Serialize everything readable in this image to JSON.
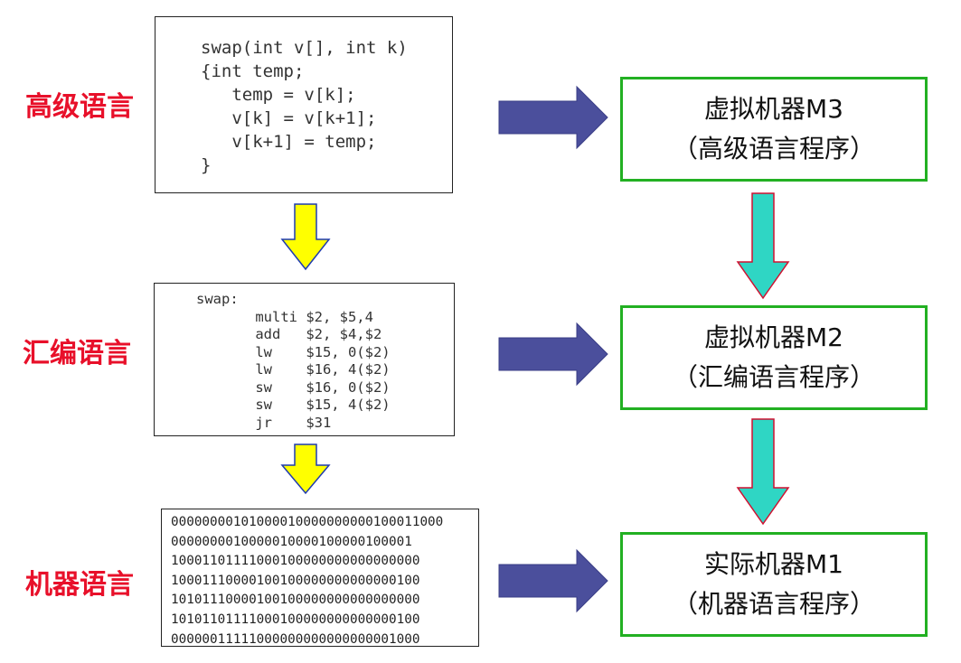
{
  "levels": [
    {
      "label": "高级语言"
    },
    {
      "label": "汇编语言"
    },
    {
      "label": "机器语言"
    }
  ],
  "high_level_code": "swap(int v[], int k)\n{int temp;\n   temp = v[k];\n   v[k] = v[k+1];\n   v[k+1] = temp;\n}",
  "assembly_code": "swap:\n       multi $2, $5,4\n       add   $2, $4,$2\n       lw    $15, 0($2)\n       lw    $16, 4($2)\n       sw    $16, 0($2)\n       sw    $15, 4($2)\n       jr    $31",
  "machine_code": "00000000101000010000000000100011000\n0000000010000010000100000100001\n10001101111000100000000000000000\n10001110000100100000000000000100\n10101110000100100000000000000000\n10101101111000100000000000000100\n00000011111000000000000000001000",
  "machines": [
    {
      "title": "虚拟机器M3",
      "subtitle": "（高级语言程序）"
    },
    {
      "title": "虚拟机器M2",
      "subtitle": "（汇编语言程序）"
    },
    {
      "title": "实际机器M1",
      "subtitle": "（机器语言程序）"
    }
  ],
  "colors": {
    "level_label": "#e8102a",
    "box_border_green": "#22b022",
    "right_arrow": "#4b4f9c",
    "down_arrow_yellow": "#ffff00",
    "down_arrow_cyan": "#2fd6c4"
  }
}
